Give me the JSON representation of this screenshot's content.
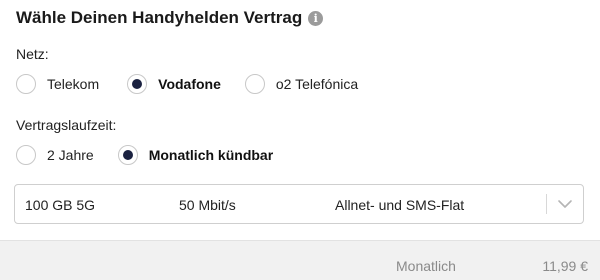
{
  "header": {
    "title": "Wähle Deinen Handyhelden Vertrag",
    "info_icon": "i"
  },
  "network": {
    "label": "Netz:",
    "options": [
      {
        "label": "Telekom",
        "selected": false
      },
      {
        "label": "Vodafone",
        "selected": true
      },
      {
        "label": "o2 Telefónica",
        "selected": false
      }
    ]
  },
  "term": {
    "label": "Vertragslaufzeit:",
    "options": [
      {
        "label": "2 Jahre",
        "selected": false
      },
      {
        "label": "Monatlich kündbar",
        "selected": true
      }
    ]
  },
  "tariff_select": {
    "data_volume": "100 GB 5G",
    "speed": "50 Mbit/s",
    "features": "Allnet- und SMS-Flat",
    "icon": "chevron-down-icon"
  },
  "footer": {
    "label": "Monatlich",
    "price": "11,99 €"
  },
  "colors": {
    "radio_selected": "#1b2241",
    "footer_bg": "#f1f1f1"
  }
}
